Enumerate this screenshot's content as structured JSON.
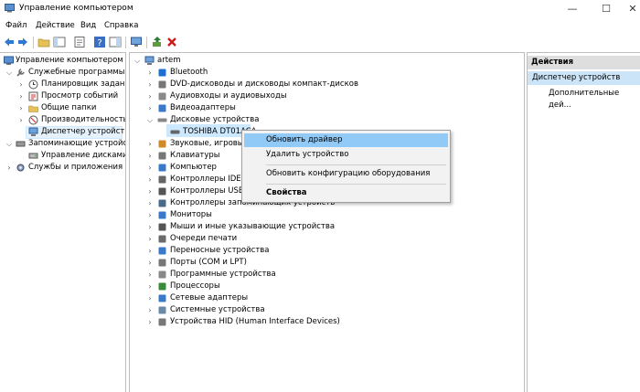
{
  "window": {
    "title": "Управление компьютером",
    "minimize": "—",
    "maximize": "☐",
    "close": "✕"
  },
  "menu": [
    "Файл",
    "Действие",
    "Вид",
    "Справка"
  ],
  "toolbar": [
    "back-icon",
    "forward-icon",
    "folder-icon",
    "console-tree-icon",
    "properties-icon",
    "help-icon",
    "view-icon",
    "monitor-icon",
    "update-driver-icon",
    "delete-icon"
  ],
  "left_tree": [
    "Управление компьютером (л",
    "Служебные программы",
    "Планировщик заданий",
    "Просмотр событий",
    "Общие папки",
    "Производительность",
    "Диспетчер устройств",
    "Запоминающие устройст",
    "Управление дисками",
    "Службы и приложения"
  ],
  "device_tree": {
    "root": "artem",
    "items": [
      "Bluetooth",
      "DVD-дисководы и дисководы компакт-дисков",
      "Аудиовходы и аудиовыходы",
      "Видеоадаптеры",
      "Дисковые устройства",
      "TOSHIBA DT01ACA",
      "Звуковые, игровые",
      "Клавиатуры",
      "Компьютер",
      "Контроллеры IDE AT",
      "Контроллеры USB",
      "Контроллеры запоминающих устройств",
      "Мониторы",
      "Мыши и иные указывающие устройства",
      "Очереди печати",
      "Переносные устройства",
      "Порты (COM и LPT)",
      "Программные устройства",
      "Процессоры",
      "Сетевые адаптеры",
      "Системные устройства",
      "Устройства HID (Human Interface Devices)"
    ]
  },
  "context_menu": [
    "Обновить драйвер",
    "Удалить устройство",
    "Обновить конфигурацию оборудования",
    "Свойства"
  ],
  "actions": {
    "header": "Действия",
    "selected": "Диспетчер устройств",
    "more": "Дополнительные дей..."
  }
}
